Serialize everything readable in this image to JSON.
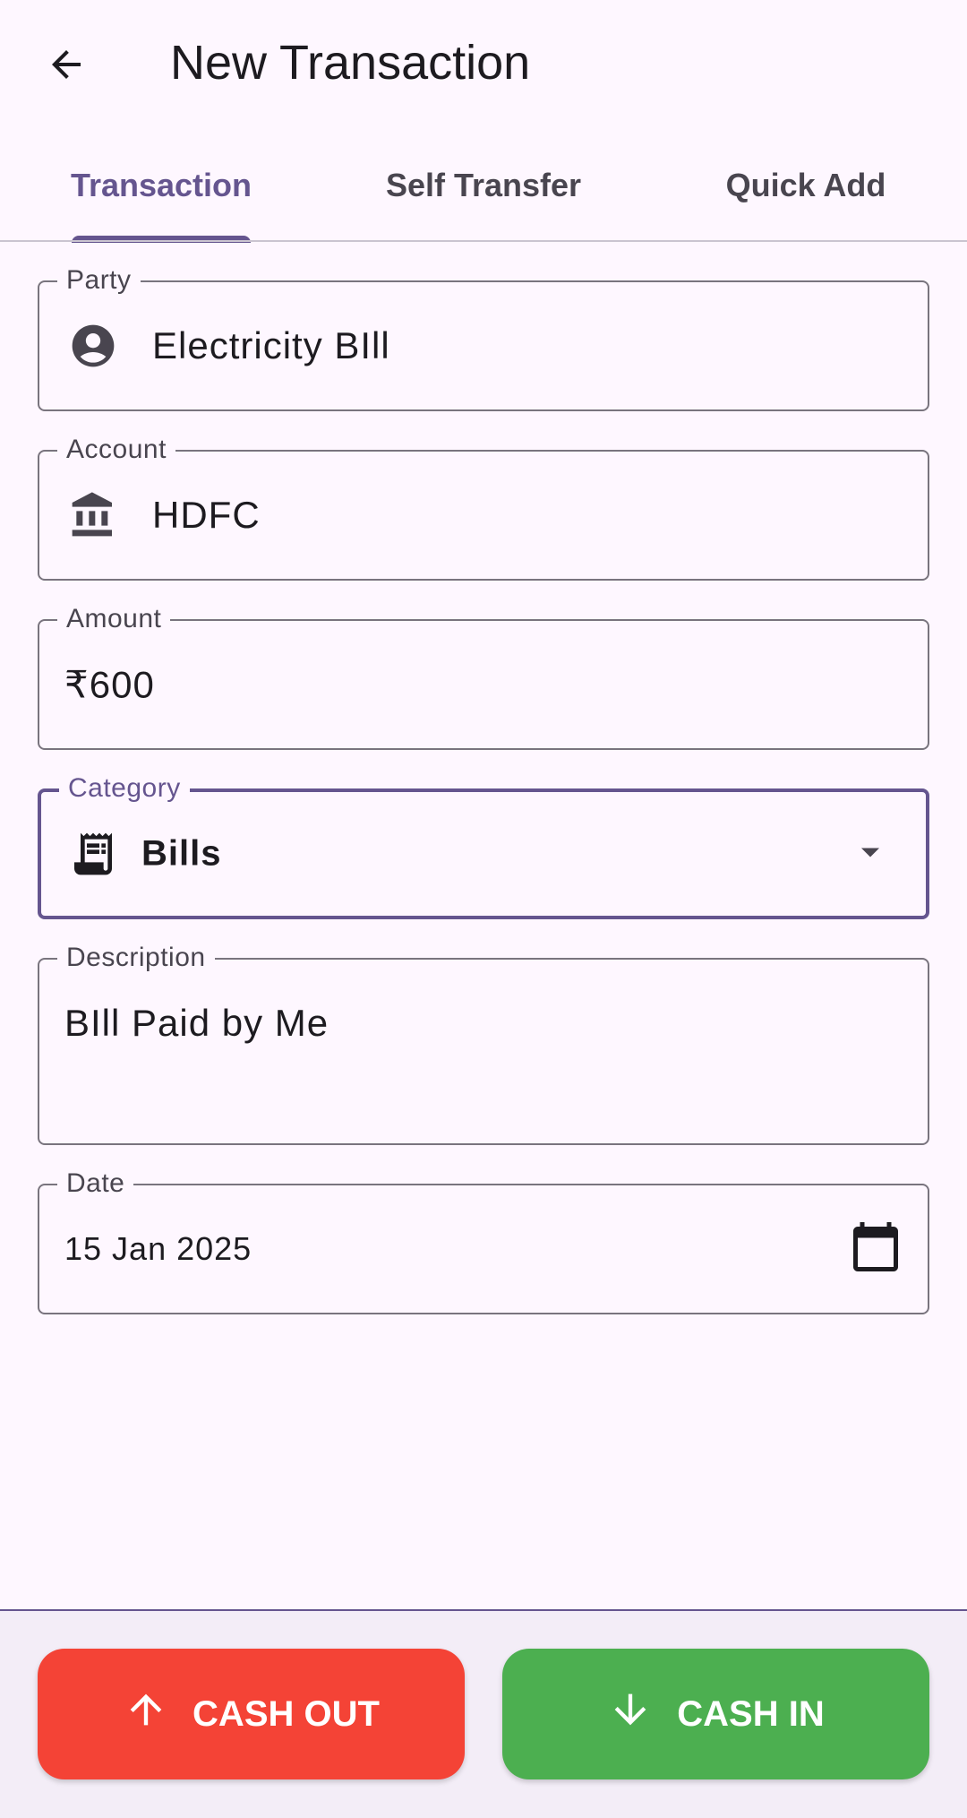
{
  "app_bar": {
    "title": "New Transaction",
    "back_icon": "arrow-back-icon"
  },
  "tabs": [
    {
      "label": "Transaction",
      "active": true
    },
    {
      "label": "Self Transfer",
      "active": false
    },
    {
      "label": "Quick Add",
      "active": false
    }
  ],
  "form": {
    "party": {
      "label": "Party",
      "value": "Electricity BIll",
      "icon": "account-circle-icon"
    },
    "account": {
      "label": "Account",
      "value": "HDFC",
      "icon": "bank-icon"
    },
    "amount": {
      "label": "Amount",
      "value": "₹600"
    },
    "category": {
      "label": "Category",
      "value": "Bills",
      "icon": "receipt-icon",
      "dropdown_icon": "arrow-drop-down-icon"
    },
    "description": {
      "label": "Description",
      "value": "BIll Paid by Me"
    },
    "date": {
      "label": "Date",
      "value": "15 Jan 2025",
      "icon": "calendar-icon"
    }
  },
  "actions": {
    "cash_out": {
      "label": "CASH OUT",
      "icon": "arrow-upward-icon",
      "color": "#f44336"
    },
    "cash_in": {
      "label": "CASH IN",
      "icon": "arrow-downward-icon",
      "color": "#4caf50"
    }
  },
  "colors": {
    "primary": "#65558f",
    "background": "#fef7ff",
    "outline": "#79747e"
  }
}
